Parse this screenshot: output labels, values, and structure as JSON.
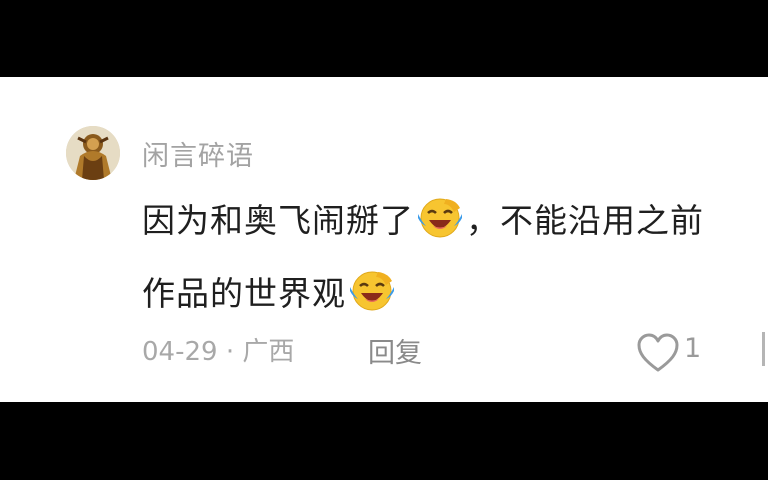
{
  "comment": {
    "username": "闲言碎语",
    "text_line1_part1": "因为和奥飞闹掰了",
    "text_line1_part2": "，不能沿用之前",
    "text_line2": "作品的世界观",
    "emoji_name": "laughing-crying-emoji",
    "date": "04-29",
    "separator": "·",
    "location": "广西",
    "reply_label": "回复",
    "like_count": "1",
    "like_icon": "heart-outline-icon"
  },
  "colors": {
    "background": "#ffffff",
    "letterbox": "#000000",
    "text": "#1f1f1f",
    "muted": "#a3a3a3",
    "emoji_yellow": "#f7c530",
    "emoji_blue": "#3b9bea"
  }
}
